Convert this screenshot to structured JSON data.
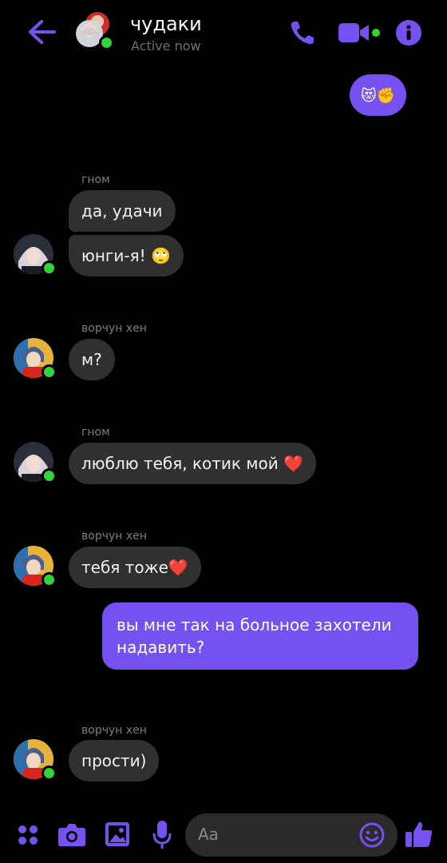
{
  "header": {
    "title": "чудаки",
    "status": "Active now",
    "icons": [
      "back-arrow-icon",
      "phone-icon",
      "video-camera-icon",
      "info-icon"
    ]
  },
  "colors": {
    "accent": "#7650f0",
    "bubble_in": "#303030",
    "online": "#31d23a"
  },
  "messages": [
    {
      "from": "me",
      "text": "😻✊"
    },
    {
      "sender": "гном",
      "text": "да, удачи"
    },
    {
      "text": "юнги-я! 🙄"
    },
    {
      "sender": "ворчун хен",
      "text": "м?"
    },
    {
      "sender": "гном",
      "text": "люблю тебя, котик мой ❤️"
    },
    {
      "sender": "ворчун хен",
      "text": "тебя тоже❤️"
    },
    {
      "from": "me",
      "text": "вы мне так на больное захотели надавить?"
    },
    {
      "sender": "ворчун хен",
      "text": "прости)"
    }
  ],
  "composer": {
    "placeholder": "Aa",
    "icons": [
      "apps-icon",
      "camera-icon",
      "gallery-icon",
      "microphone-icon",
      "emoji-icon",
      "thumbs-up-icon"
    ]
  }
}
